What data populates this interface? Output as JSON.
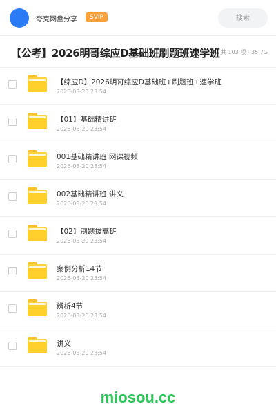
{
  "header": {
    "app_name": "夸克网盘分享",
    "badge": "SVIP",
    "search_placeholder": "搜索",
    "avatar_color": "#2b7bf7"
  },
  "share": {
    "title": "【公考】2026明哥综应D基础班刷题班速学班",
    "meta": "共 103 项 · 35.7G"
  },
  "items": [
    {
      "name": "【综应D】2026明哥综应D基础班+刷题班+速学班",
      "date": "2026-03-20 23:54",
      "icon": "folder-icon"
    },
    {
      "name": "【01】基础精讲班",
      "date": "2026-03-20 23:54",
      "icon": "folder-icon"
    },
    {
      "name": "001基础精讲班 网课视频",
      "date": "2026-03-20 23:54",
      "icon": "folder-icon"
    },
    {
      "name": "002基础精讲班 讲义",
      "date": "2026-03-20 23:54",
      "icon": "folder-icon"
    },
    {
      "name": "【02】刷题拔高班",
      "date": "2026-03-20 23:54",
      "icon": "folder-icon"
    },
    {
      "name": "案例分析14节",
      "date": "2026-03-20 23:54",
      "icon": "folder-icon"
    },
    {
      "name": "辨析4节",
      "date": "2026-03-20 23:54",
      "icon": "folder-icon"
    },
    {
      "name": "讲义",
      "date": "2026-03-20 23:54",
      "icon": "folder-icon"
    }
  ],
  "watermark": "miosou.cc",
  "colors": {
    "accent": "#2b7bf7",
    "badge": "#f8a13b",
    "folder": "#fdd23f",
    "watermark": "#2ec45a"
  }
}
